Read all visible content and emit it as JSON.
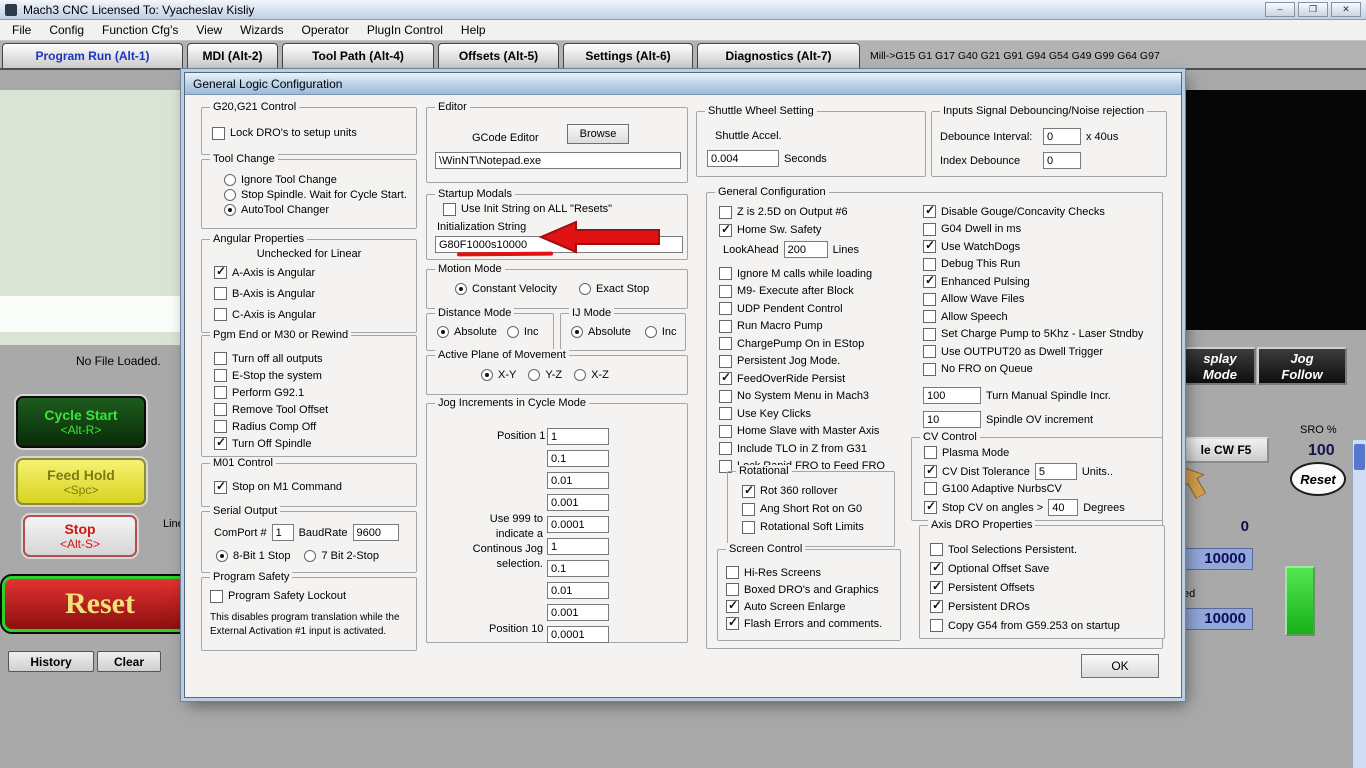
{
  "window": {
    "title": "Mach3 CNC  Licensed To: Vyacheslav Kisliy",
    "menu": [
      "File",
      "Config",
      "Function Cfg's",
      "View",
      "Wizards",
      "Operator",
      "PlugIn Control",
      "Help"
    ],
    "tabs": [
      {
        "label": "Program Run (Alt-1)",
        "active": true
      },
      {
        "label": "MDI (Alt-2)",
        "active": false
      },
      {
        "label": "Tool Path (Alt-4)",
        "active": false
      },
      {
        "label": "Offsets (Alt-5)",
        "active": false
      },
      {
        "label": "Settings (Alt-6)",
        "active": false
      },
      {
        "label": "Diagnostics (Alt-7)",
        "active": false
      }
    ],
    "modes_readout": "Mill->G15  G1 G17 G40 G21 G91 G94 G54 G49 G99 G64 G97",
    "controls": {
      "minimize": "–",
      "maximize": "❐",
      "close": "✕"
    }
  },
  "left_panel": {
    "no_file": "No File Loaded.",
    "cycle_start_line1": "Cycle Start",
    "cycle_start_line2": "<Alt-R>",
    "feed_hold_line1": "Feed Hold",
    "feed_hold_line2": "<Spc>",
    "stop_line1": "Stop",
    "stop_line2": "<Alt-S>",
    "reset_label": "Reset",
    "history_label": "History",
    "clear_label": "Clear",
    "line_label": "Line"
  },
  "right_panel": {
    "display_mode_line1": "splay",
    "display_mode_line2": "Mode",
    "jog_follow_line1": "Jog",
    "jog_follow_line2": "Follow",
    "spindle_button_partial": "le CW F5",
    "sro_label": "SRO %",
    "sro_value": "100",
    "reset_round_label": "Reset",
    "dro_top": "0",
    "dro_mid": "10000",
    "dro_bottom": "10000",
    "speed_partial": "ed"
  },
  "dialog": {
    "title": "General Logic Configuration",
    "ok_label": "OK",
    "g20": {
      "title": "G20,G21 Control",
      "items": [
        {
          "label": "Lock DRO's to setup units",
          "checked": false
        }
      ]
    },
    "tool_change": {
      "title": "Tool Change",
      "items": [
        {
          "label": "Ignore Tool Change",
          "radio": true,
          "checked": false
        },
        {
          "label": "Stop Spindle. Wait for Cycle Start.",
          "radio": true,
          "checked": false
        },
        {
          "label": "AutoTool Changer",
          "radio": true,
          "checked": true
        }
      ]
    },
    "angular": {
      "title": "Angular Properties",
      "note": "Unchecked for Linear",
      "items": [
        {
          "label": "A-Axis is Angular",
          "checked": true
        },
        {
          "label": "B-Axis is Angular",
          "checked": false
        },
        {
          "label": "C-Axis is Angular",
          "checked": false
        }
      ]
    },
    "pgm_end": {
      "title": "Pgm End or M30 or Rewind",
      "items": [
        {
          "label": "Turn off all outputs",
          "checked": false
        },
        {
          "label": "E-Stop the system",
          "checked": false
        },
        {
          "label": "Perform G92.1",
          "checked": false
        },
        {
          "label": "Remove Tool Offset",
          "checked": false
        },
        {
          "label": "Radius Comp Off",
          "checked": false
        },
        {
          "label": "Turn Off Spindle",
          "checked": true
        }
      ]
    },
    "m01": {
      "title": "M01 Control",
      "items": [
        {
          "label": "Stop on M1 Command",
          "checked": true
        }
      ]
    },
    "serial": {
      "title": "Serial Output",
      "comport_label": "ComPort #",
      "comport_value": "1",
      "baud_label": "BaudRate",
      "baud_value": "9600",
      "items": [
        {
          "label": "8-Bit 1 Stop",
          "radio": true,
          "checked": true
        },
        {
          "label": "7 Bit 2-Stop",
          "radio": true,
          "checked": false
        }
      ]
    },
    "program_safety": {
      "title": "Program Safety",
      "items": [
        {
          "label": "Program Safety Lockout",
          "checked": false
        }
      ],
      "note1": "This disables program translation while the",
      "note2": "External Activation #1 input is activated."
    },
    "editor": {
      "title": "Editor",
      "gcode_label": "GCode Editor",
      "browse_label": "Browse",
      "path_value": "\\WinNT\\Notepad.exe"
    },
    "startup": {
      "title": "Startup Modals",
      "items": [
        {
          "label": "Use Init String on ALL  \"Resets\"",
          "checked": false
        }
      ],
      "init_label": "Initialization String",
      "init_value": "G80F1000s10000"
    },
    "motion": {
      "title": "Motion Mode",
      "items": [
        {
          "label": "Constant Velocity",
          "radio": true,
          "checked": true
        },
        {
          "label": "Exact Stop",
          "radio": true,
          "checked": false
        }
      ]
    },
    "distance": {
      "title": "Distance Mode",
      "items": [
        {
          "label": "Absolute",
          "radio": true,
          "checked": true
        },
        {
          "label": "Inc",
          "radio": true,
          "checked": false
        }
      ]
    },
    "ij": {
      "title": "IJ Mode",
      "items": [
        {
          "label": "Absolute",
          "radio": true,
          "checked": true
        },
        {
          "label": "Inc",
          "radio": true,
          "checked": false
        }
      ]
    },
    "plane": {
      "title": "Active Plane of Movement",
      "items": [
        {
          "label": "X-Y",
          "radio": true,
          "checked": true
        },
        {
          "label": "Y-Z",
          "radio": true,
          "checked": false
        },
        {
          "label": "X-Z",
          "radio": true,
          "checked": false
        }
      ]
    },
    "jog": {
      "title": "Jog Increments in Cycle Mode",
      "pos1_label": "Position 1",
      "pos10_label": "Position 10",
      "note": "Use 999 to indicate a Continous Jog selection.",
      "values": [
        "1",
        "0.1",
        "0.01",
        "0.001",
        "0.0001",
        "1",
        "0.1",
        "0.01",
        "0.001",
        "0.0001"
      ]
    },
    "shuttle": {
      "title": "Shuttle Wheel Setting",
      "accel_label": "Shuttle Accel.",
      "accel_value": "0.004",
      "seconds_label": "Seconds"
    },
    "debounce": {
      "title": "Inputs Signal Debouncing/Noise rejection",
      "interval_label": "Debounce Interval:",
      "interval_value": "0",
      "interval_unit": "x 40us",
      "index_label": "Index Debounce",
      "index_value": "0"
    },
    "general": {
      "title": "General Configuration",
      "left_top": [
        {
          "label": "Z is 2.5D on Output #6",
          "checked": false
        },
        {
          "label": "Home Sw. Safety",
          "checked": true
        }
      ],
      "lookahead_label": "LookAhead",
      "lookahead_value": "200",
      "lookahead_unit": "Lines",
      "left_items": [
        {
          "label": "Ignore M calls while loading",
          "checked": false
        },
        {
          "label": "M9- Execute after Block",
          "checked": false
        },
        {
          "label": "UDP Pendent Control",
          "checked": false
        },
        {
          "label": "Run Macro Pump",
          "checked": false
        },
        {
          "label": "ChargePump On in EStop",
          "checked": false
        },
        {
          "label": "Persistent Jog Mode.",
          "checked": false
        },
        {
          "label": "FeedOverRide Persist",
          "checked": true
        },
        {
          "label": "No System Menu in Mach3",
          "checked": false
        },
        {
          "label": "Use Key Clicks",
          "checked": false
        },
        {
          "label": "Home Slave with Master Axis",
          "checked": false
        },
        {
          "label": "Include TLO in Z from G31",
          "checked": false
        },
        {
          "label": "Lock Rapid FRO to Feed FRO",
          "checked": false
        }
      ],
      "right_items": [
        {
          "label": "Disable Gouge/Concavity Checks",
          "checked": true
        },
        {
          "label": "G04 Dwell in ms",
          "checked": false
        },
        {
          "label": "Use WatchDogs",
          "checked": true
        },
        {
          "label": "Debug This Run",
          "checked": false
        },
        {
          "label": "Enhanced Pulsing",
          "checked": true
        },
        {
          "label": "Allow Wave Files",
          "checked": false
        },
        {
          "label": "Allow Speech",
          "checked": false
        },
        {
          "label": "Set Charge Pump to 5Khz  - Laser Stndby",
          "checked": false
        },
        {
          "label": "Use OUTPUT20 as Dwell Trigger",
          "checked": false
        },
        {
          "label": "No FRO on Queue",
          "checked": false
        }
      ],
      "spindle_incr_value": "100",
      "spindle_incr_label": "Turn Manual Spindle Incr.",
      "spindle_ov_value": "10",
      "spindle_ov_label": "Spindle OV increment"
    },
    "rotational": {
      "title": "Rotational",
      "items": [
        {
          "label": "Rot 360 rollover",
          "checked": true
        },
        {
          "label": "Ang Short Rot on G0",
          "checked": false
        },
        {
          "label": "Rotational Soft Limits",
          "checked": false
        }
      ]
    },
    "screen": {
      "title": "Screen Control",
      "items": [
        {
          "label": "Hi-Res Screens",
          "checked": false
        },
        {
          "label": "Boxed DRO's and Graphics",
          "checked": false
        },
        {
          "label": "Auto Screen Enlarge",
          "checked": true
        },
        {
          "label": "Flash Errors and comments.",
          "checked": true
        }
      ]
    },
    "cv": {
      "title": "CV Control",
      "plasma_label": "Plasma Mode",
      "dist_label": "CV Dist Tolerance",
      "dist_value": "5",
      "dist_unit": "Units..",
      "nurbs_label": "G100 Adaptive NurbsCV",
      "angle_label": "Stop CV on angles >",
      "angle_value": "40",
      "angle_unit": "Degrees"
    },
    "axis_dro": {
      "title": "Axis DRO Properties",
      "items": [
        {
          "label": "Tool Selections Persistent.",
          "checked": false
        },
        {
          "label": "Optional Offset Save",
          "checked": true
        },
        {
          "label": "Persistent Offsets",
          "checked": true
        },
        {
          "label": "Persistent DROs",
          "checked": true
        },
        {
          "label": "Copy G54 from G59.253 on startup",
          "checked": false
        }
      ]
    }
  },
  "annotation": {
    "arrow_icon": "red-left-arrow",
    "underline": "red-underline",
    "color": "#e01212"
  },
  "colors": {
    "dialog_bg": "#f4f3f1",
    "annotation_red": "#e01212",
    "cycle_green": "#35e635",
    "feed_yellow": "#eee84e",
    "stop_red": "#d41414",
    "dro_strip": "#93a8d9"
  }
}
